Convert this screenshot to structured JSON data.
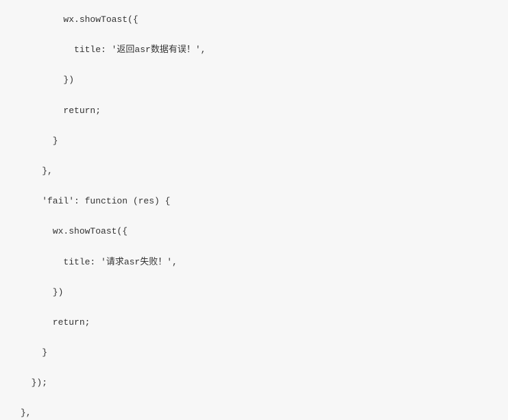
{
  "code": {
    "lines": [
      "        wx.showToast({",
      "          title: '返回asr数据有误！',",
      "        })",
      "        return;",
      "      }",
      "    },",
      "    'fail': function (res) {",
      "      wx.showToast({",
      "        title: '请求asr失败！',",
      "      })",
      "      return;",
      "    }",
      "  });",
      "},"
    ]
  }
}
